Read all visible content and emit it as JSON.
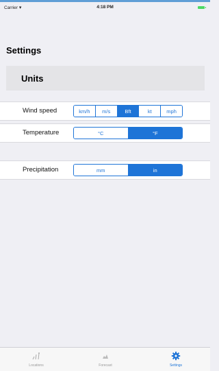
{
  "status_bar": {
    "carrier": "Carrier",
    "time": "4:18 PM"
  },
  "page": {
    "title": "Settings"
  },
  "section": {
    "title": "Units"
  },
  "settings": [
    {
      "label": "Wind speed",
      "options": [
        "km/h",
        "m/s",
        "Bft",
        "kt",
        "mph"
      ],
      "selected": "Bft"
    },
    {
      "label": "Temperature",
      "options": [
        "°C",
        "°F"
      ],
      "selected": "°F"
    },
    {
      "label": "Precipitation",
      "options": [
        "mm",
        "in"
      ],
      "selected": "in"
    }
  ],
  "tabbar": {
    "tabs": [
      {
        "label": "Locations",
        "icon": "locations-icon"
      },
      {
        "label": "Forecast",
        "icon": "forecast-icon"
      },
      {
        "label": "Settings",
        "icon": "gear-icon",
        "active": true
      }
    ]
  },
  "colors": {
    "accent": "#1e74d7",
    "background": "#efeff4",
    "battery": "#4cd964"
  }
}
